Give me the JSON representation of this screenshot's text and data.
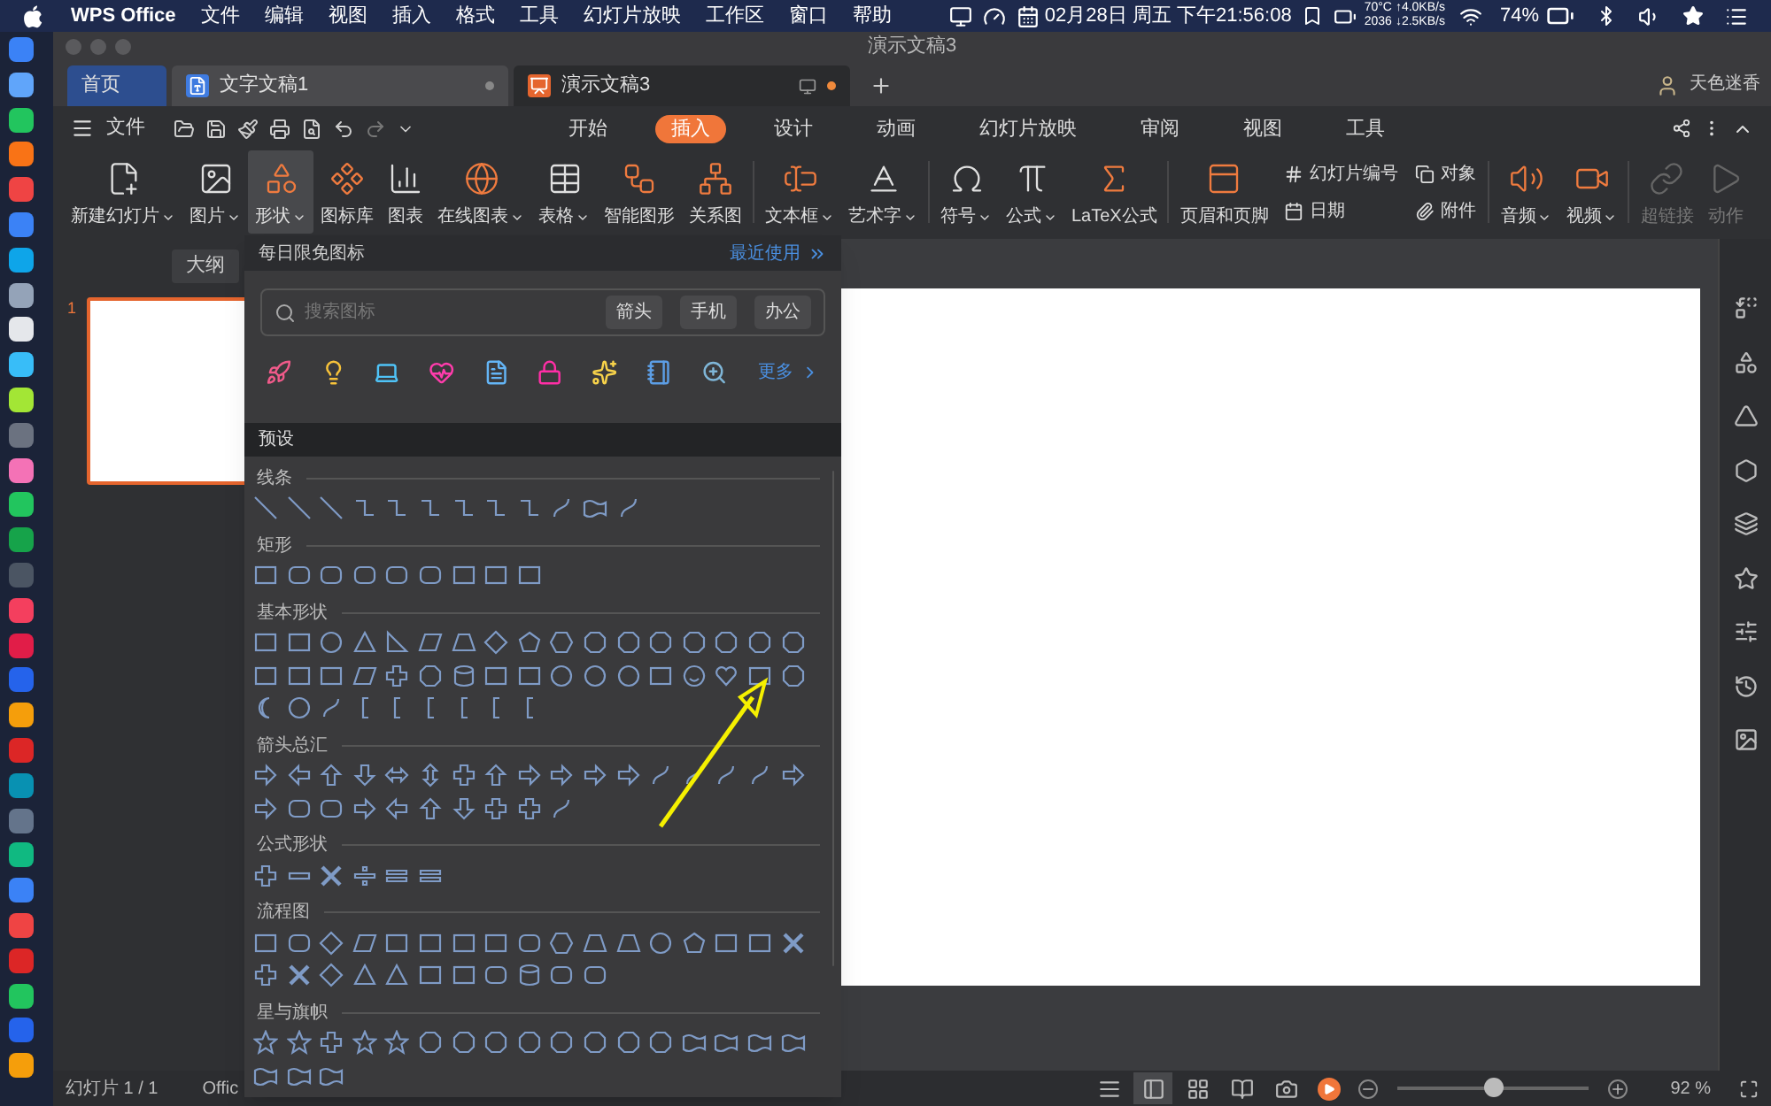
{
  "menubar": {
    "app": "WPS Office",
    "menus": [
      "文件",
      "编辑",
      "视图",
      "插入",
      "格式",
      "工具",
      "幻灯片放映",
      "工作区",
      "窗口",
      "帮助"
    ],
    "temp": "70°C",
    "fan": "2036",
    "upload": "↑4.0KB/s",
    "download": "↓2.5KB/s",
    "datetime": "02月28日 周五 下午21:56:08",
    "battery": "74%"
  },
  "window": {
    "title": "演示文稿3"
  },
  "doc_tabs": [
    {
      "label": "首页",
      "kind": "home",
      "selected": false
    },
    {
      "label": "文字文稿1",
      "kind": "writer",
      "selected": false
    },
    {
      "label": "演示文稿3",
      "kind": "slides",
      "selected": true
    }
  ],
  "user": "天色迷香",
  "file_menu": "文件",
  "ribbon_tabs": [
    {
      "label": "开始",
      "selected": false
    },
    {
      "label": "插入",
      "selected": true
    },
    {
      "label": "设计",
      "selected": false
    },
    {
      "label": "动画",
      "selected": false
    },
    {
      "label": "幻灯片放映",
      "selected": false
    },
    {
      "label": "审阅",
      "selected": false
    },
    {
      "label": "视图",
      "selected": false
    },
    {
      "label": "工具",
      "selected": false
    }
  ],
  "ribbon": [
    {
      "kind": "large",
      "label": "新建幻灯片",
      "dropdown": true,
      "pressed": false,
      "disabled": false
    },
    {
      "kind": "large",
      "label": "图片",
      "dropdown": true,
      "pressed": false,
      "disabled": false
    },
    {
      "kind": "large",
      "label": "形状",
      "dropdown": true,
      "pressed": true,
      "disabled": false
    },
    {
      "kind": "large",
      "label": "图标库",
      "dropdown": false,
      "pressed": false,
      "disabled": false
    },
    {
      "kind": "large",
      "label": "图表",
      "dropdown": false,
      "pressed": false,
      "disabled": false
    },
    {
      "kind": "large",
      "label": "在线图表",
      "dropdown": true,
      "pressed": false,
      "disabled": false
    },
    {
      "kind": "large",
      "label": "表格",
      "dropdown": true,
      "pressed": false,
      "disabled": false
    },
    {
      "kind": "large",
      "label": "智能图形",
      "dropdown": false,
      "pressed": false,
      "disabled": false
    },
    {
      "kind": "large",
      "label": "关系图",
      "dropdown": false,
      "pressed": false,
      "disabled": false
    },
    {
      "kind": "divider"
    },
    {
      "kind": "large",
      "label": "文本框",
      "dropdown": true,
      "pressed": false,
      "disabled": false
    },
    {
      "kind": "large",
      "label": "艺术字",
      "dropdown": true,
      "pressed": false,
      "disabled": false
    },
    {
      "kind": "divider"
    },
    {
      "kind": "large",
      "label": "符号",
      "dropdown": true,
      "pressed": false,
      "disabled": false
    },
    {
      "kind": "large",
      "label": "公式",
      "dropdown": true,
      "pressed": false,
      "disabled": false
    },
    {
      "kind": "large",
      "label": "LaTeX公式",
      "dropdown": false,
      "pressed": false,
      "disabled": false
    },
    {
      "kind": "divider"
    },
    {
      "kind": "large",
      "label": "页眉和页脚",
      "dropdown": false,
      "pressed": false,
      "disabled": false
    },
    {
      "kind": "stack",
      "items": [
        "幻灯片编号",
        "日期"
      ]
    },
    {
      "kind": "stack",
      "items": [
        "对象",
        "附件"
      ]
    },
    {
      "kind": "divider"
    },
    {
      "kind": "large",
      "label": "音频",
      "dropdown": true,
      "pressed": false,
      "disabled": false
    },
    {
      "kind": "large",
      "label": "视频",
      "dropdown": true,
      "pressed": false,
      "disabled": false
    },
    {
      "kind": "divider"
    },
    {
      "kind": "large",
      "label": "超链接",
      "dropdown": false,
      "pressed": false,
      "disabled": true
    },
    {
      "kind": "large",
      "label": "动作",
      "dropdown": false,
      "pressed": false,
      "disabled": true
    }
  ],
  "panel_tab": "大纲",
  "slide_number": "1",
  "shapes_menu": {
    "daily_title": "每日限免图标",
    "recent": "最近使用",
    "search_placeholder": "搜索图标",
    "tags": [
      "箭头",
      "手机",
      "办公"
    ],
    "more": "更多",
    "preset": "预设",
    "sections": [
      {
        "title": "线条"
      },
      {
        "title": "矩形"
      },
      {
        "title": "基本形状"
      },
      {
        "title": "箭头总汇"
      },
      {
        "title": "公式形状"
      },
      {
        "title": "流程图"
      },
      {
        "title": "星与旗帜"
      }
    ]
  },
  "status": {
    "slide": "幻灯片 1 / 1",
    "theme": "Offic",
    "zoom": "92 %",
    "views": [
      {
        "selected": false
      },
      {
        "selected": true
      },
      {
        "selected": false
      },
      {
        "selected": false
      },
      {
        "selected": false
      }
    ],
    "zoom_slider": {
      "level": 0.5
    }
  }
}
